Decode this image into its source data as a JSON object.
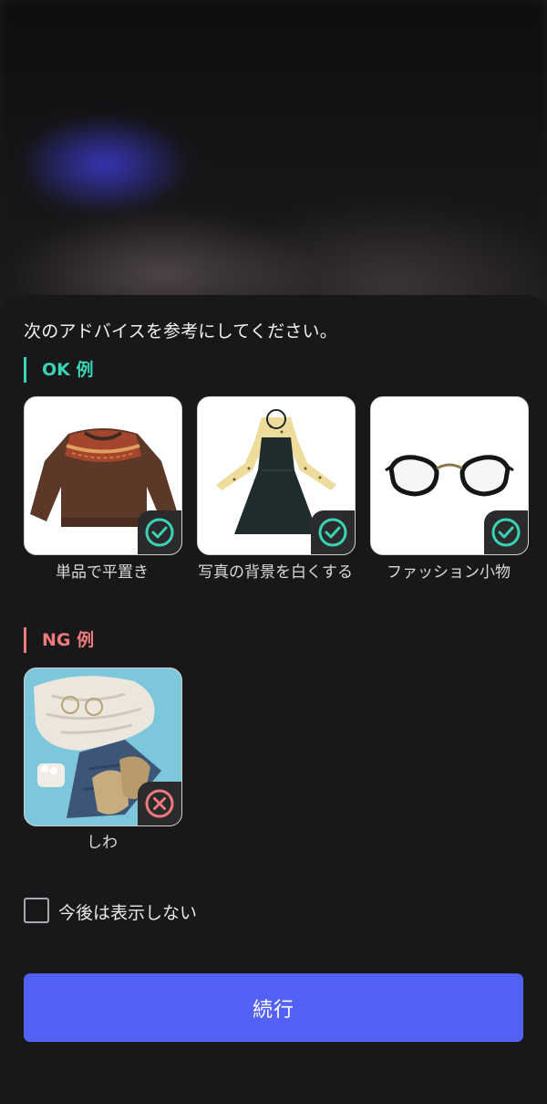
{
  "dialog": {
    "intro": "次のアドバイスを参考にしてください。",
    "ok_title": "OK 例",
    "ng_title": "NG 例"
  },
  "ok_examples": [
    {
      "caption": "単品で平置き",
      "image": "knit-sweater",
      "status_icon": "check-circle-icon"
    },
    {
      "caption": "写真の背景を白くする",
      "image": "black-dress-with-polka-dot-blouse",
      "status_icon": "check-circle-icon"
    },
    {
      "caption": "ファッション小物",
      "image": "eyeglasses",
      "status_icon": "check-circle-icon"
    }
  ],
  "ng_examples": [
    {
      "caption": "しわ",
      "image": "wrinkled-clothes-flatlay",
      "status_icon": "x-circle-icon"
    }
  ],
  "dont_show_again": {
    "label": "今後は表示しない",
    "checked": false
  },
  "continue_button": {
    "label": "続行"
  },
  "colors": {
    "ok_accent": "#3ad3b3",
    "ng_accent": "#ee7b7c",
    "primary_button": "#5461f7",
    "sheet_bg": "#18181b"
  }
}
